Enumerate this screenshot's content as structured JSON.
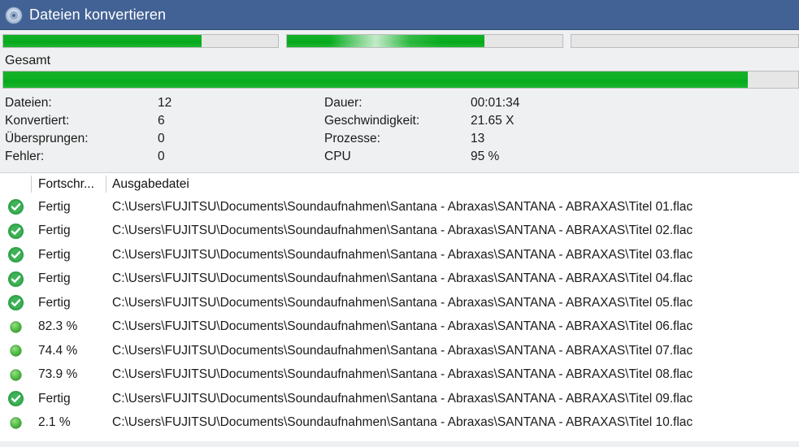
{
  "window": {
    "title": "Dateien konvertieren",
    "icon": "disc-icon",
    "titlebar_color": "#426295"
  },
  "top_progress_bars": [
    {
      "name": "process-bar-1",
      "percent": 72.3,
      "shimmer": false
    },
    {
      "name": "process-bar-2",
      "percent": 71.6,
      "shimmer": true
    },
    {
      "name": "process-bar-3",
      "percent": 0,
      "shimmer": false
    }
  ],
  "overall": {
    "label": "Gesamt",
    "percent": 93.7
  },
  "stats": {
    "left": [
      {
        "label": "Dateien:",
        "value": "12"
      },
      {
        "label": "Konvertiert:",
        "value": "6"
      },
      {
        "label": "Übersprungen:",
        "value": "0"
      },
      {
        "label": "Fehler:",
        "value": "0"
      }
    ],
    "right": [
      {
        "label": "Dauer:",
        "value": "00:01:34"
      },
      {
        "label": "Geschwindigkeit:",
        "value": "21.65 X"
      },
      {
        "label": "Prozesse:",
        "value": "13"
      },
      {
        "label": "CPU",
        "value": "95 %"
      }
    ]
  },
  "file_list": {
    "columns": {
      "progress": "Fortschr...",
      "output": "Ausgabedatei"
    },
    "rows": [
      {
        "icon": "check-circle-icon",
        "status": "Fertig",
        "path": "C:\\Users\\FUJITSU\\Documents\\Soundaufnahmen\\Santana - Abraxas\\SANTANA - ABRAXAS\\Titel 01.flac"
      },
      {
        "icon": "check-circle-icon",
        "status": "Fertig",
        "path": "C:\\Users\\FUJITSU\\Documents\\Soundaufnahmen\\Santana - Abraxas\\SANTANA - ABRAXAS\\Titel 02.flac"
      },
      {
        "icon": "check-circle-icon",
        "status": "Fertig",
        "path": "C:\\Users\\FUJITSU\\Documents\\Soundaufnahmen\\Santana - Abraxas\\SANTANA - ABRAXAS\\Titel 03.flac"
      },
      {
        "icon": "check-circle-icon",
        "status": "Fertig",
        "path": "C:\\Users\\FUJITSU\\Documents\\Soundaufnahmen\\Santana - Abraxas\\SANTANA - ABRAXAS\\Titel 04.flac"
      },
      {
        "icon": "check-circle-icon",
        "status": "Fertig",
        "path": "C:\\Users\\FUJITSU\\Documents\\Soundaufnahmen\\Santana - Abraxas\\SANTANA - ABRAXAS\\Titel 05.flac"
      },
      {
        "icon": "busy-circle-icon",
        "status": "82.3 %",
        "path": "C:\\Users\\FUJITSU\\Documents\\Soundaufnahmen\\Santana - Abraxas\\SANTANA - ABRAXAS\\Titel 06.flac"
      },
      {
        "icon": "busy-circle-icon",
        "status": "74.4 %",
        "path": "C:\\Users\\FUJITSU\\Documents\\Soundaufnahmen\\Santana - Abraxas\\SANTANA - ABRAXAS\\Titel 07.flac"
      },
      {
        "icon": "busy-circle-icon",
        "status": "73.9 %",
        "path": "C:\\Users\\FUJITSU\\Documents\\Soundaufnahmen\\Santana - Abraxas\\SANTANA - ABRAXAS\\Titel 08.flac"
      },
      {
        "icon": "check-circle-icon",
        "status": "Fertig",
        "path": "C:\\Users\\FUJITSU\\Documents\\Soundaufnahmen\\Santana - Abraxas\\SANTANA - ABRAXAS\\Titel 09.flac"
      },
      {
        "icon": "busy-circle-icon",
        "status": "2.1 %",
        "path": "C:\\Users\\FUJITSU\\Documents\\Soundaufnahmen\\Santana - Abraxas\\SANTANA - ABRAXAS\\Titel 10.flac"
      }
    ]
  },
  "colors": {
    "progress_green": "#0caf22",
    "done_green": "#33aa44",
    "busy_green": "#4cbe4c"
  }
}
